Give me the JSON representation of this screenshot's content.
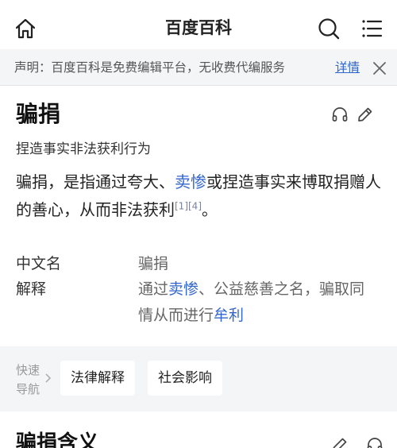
{
  "header": {
    "title": "百度百科",
    "icons": {
      "home": "home-icon",
      "search": "search-icon",
      "menu": "menu-icon"
    }
  },
  "notice": {
    "text": "声明：百度百科是免费编辑平台，无收费代编服务",
    "link": "详情",
    "close_icon": "close-icon"
  },
  "lemma": {
    "title": "骗捐",
    "subtitle": "捏造事实非法获利行为",
    "actions": {
      "listen": "headphones-icon",
      "edit": "pencil-icon"
    }
  },
  "summary": {
    "part1": "骗捐，是指通过夸大、",
    "link1": "卖惨",
    "part2": "或捏造事实来博取捐赠人的善心，从而非法获利",
    "refs": "[1][4]",
    "part3": "。"
  },
  "basic_info": {
    "rows": [
      {
        "key": "中文名",
        "value": "骗捐"
      },
      {
        "key": "解释",
        "value_pre": "通过",
        "value_link1": "卖惨",
        "value_mid": "、公益慈善之名，骗取同情从而进行",
        "value_link2": "牟利"
      }
    ]
  },
  "quick_nav": {
    "label": "快速导航",
    "items": [
      "法律解释",
      "社会影响"
    ]
  },
  "section": {
    "title": "骗捐含义",
    "actions": {
      "edit": "pencil-icon",
      "listen": "headphones-icon"
    }
  },
  "colors": {
    "link": "#3366cc",
    "notice_bg": "#f4f5f7",
    "muted": "#999999"
  }
}
